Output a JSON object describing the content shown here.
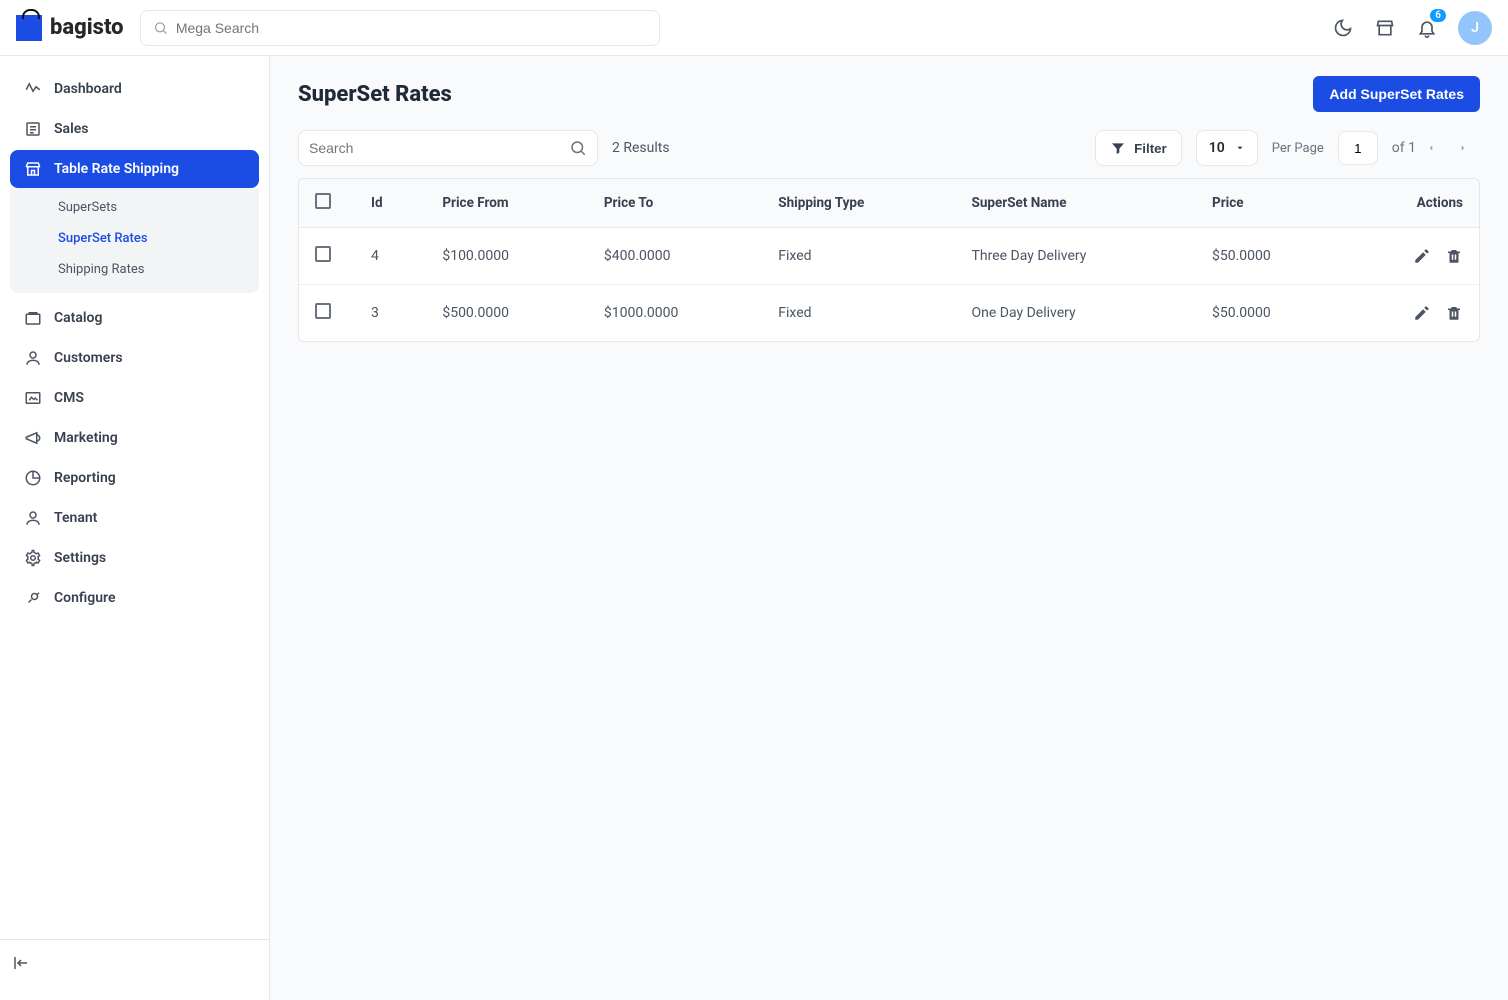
{
  "brand": {
    "name": "bagisto"
  },
  "header": {
    "search_placeholder": "Mega Search",
    "notification_count": "6",
    "avatar_initial": "J"
  },
  "sidebar": {
    "items": [
      {
        "key": "dashboard",
        "label": "Dashboard"
      },
      {
        "key": "sales",
        "label": "Sales"
      },
      {
        "key": "table-rate-shipping",
        "label": "Table Rate Shipping",
        "active": true
      },
      {
        "key": "catalog",
        "label": "Catalog"
      },
      {
        "key": "customers",
        "label": "Customers"
      },
      {
        "key": "cms",
        "label": "CMS"
      },
      {
        "key": "marketing",
        "label": "Marketing"
      },
      {
        "key": "reporting",
        "label": "Reporting"
      },
      {
        "key": "tenant",
        "label": "Tenant"
      },
      {
        "key": "settings",
        "label": "Settings"
      },
      {
        "key": "configure",
        "label": "Configure"
      }
    ],
    "subitems": [
      {
        "label": "SuperSets"
      },
      {
        "label": "SuperSet Rates",
        "current": true
      },
      {
        "label": "Shipping Rates"
      }
    ]
  },
  "page": {
    "title": "SuperSet Rates",
    "primary_action": "Add SuperSet Rates"
  },
  "toolbar": {
    "search_placeholder": "Search",
    "results_text": "2 Results",
    "filter_label": "Filter",
    "per_page_value": "10",
    "per_page_label": "Per Page",
    "page_value": "1",
    "page_of_text": "of 1"
  },
  "table": {
    "columns": [
      "",
      "Id",
      "Price From",
      "Price To",
      "Shipping Type",
      "SuperSet Name",
      "Price",
      "Actions"
    ],
    "rows": [
      {
        "id": "4",
        "price_from": "$100.0000",
        "price_to": "$400.0000",
        "shipping_type": "Fixed",
        "superset_name": "Three Day Delivery",
        "price": "$50.0000"
      },
      {
        "id": "3",
        "price_from": "$500.0000",
        "price_to": "$1000.0000",
        "shipping_type": "Fixed",
        "superset_name": "One Day Delivery",
        "price": "$50.0000"
      }
    ]
  }
}
